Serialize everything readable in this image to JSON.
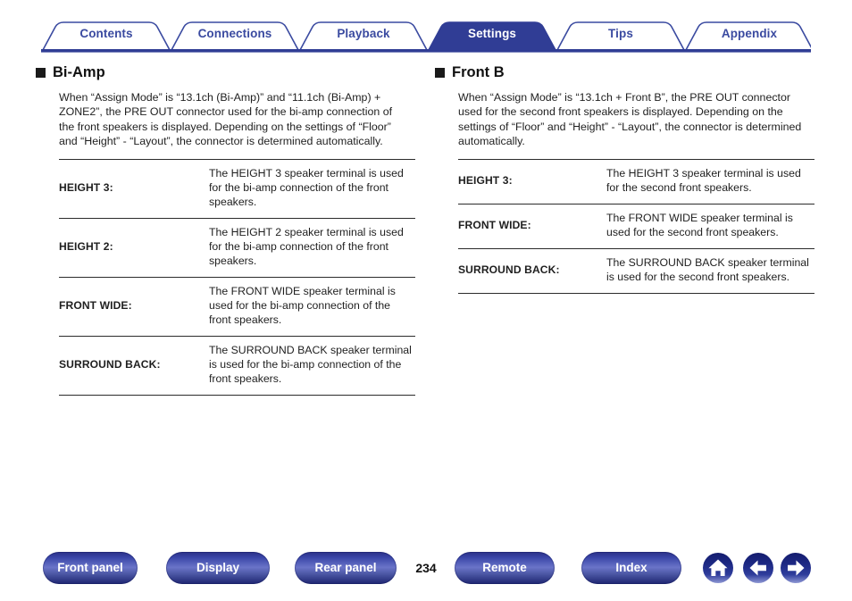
{
  "tabs": [
    {
      "label": "Contents",
      "active": false
    },
    {
      "label": "Connections",
      "active": false
    },
    {
      "label": "Playback",
      "active": false
    },
    {
      "label": "Settings",
      "active": true
    },
    {
      "label": "Tips",
      "active": false
    },
    {
      "label": "Appendix",
      "active": false
    }
  ],
  "colors": {
    "tab_text": "#3a4aa0",
    "tab_active_bg": "#303d95",
    "tab_active_text": "#ffffff",
    "rule": "#2b2b2b",
    "button_navy": "#1d2470"
  },
  "left_section": {
    "heading": "Bi-Amp",
    "body": "When “Assign Mode” is “13.1ch (Bi-Amp)” and “11.1ch (Bi-Amp) + ZONE2”, the PRE OUT connector used for the bi-amp connection of the front speakers is displayed. Depending on the settings of “Floor” and “Height” - “Layout”, the connector is determined automatically.",
    "rows": [
      {
        "term": "HEIGHT 3:",
        "desc": "The HEIGHT 3 speaker terminal is used for the bi-amp connection of the front speakers."
      },
      {
        "term": "HEIGHT 2:",
        "desc": "The HEIGHT 2 speaker terminal is used for the bi-amp connection of the front speakers."
      },
      {
        "term": "FRONT WIDE:",
        "desc": "The FRONT WIDE speaker terminal is used for the bi-amp connection of the front speakers."
      },
      {
        "term": "SURROUND BACK:",
        "desc": "The SURROUND BACK speaker terminal is used for the bi-amp connection of the front speakers."
      }
    ]
  },
  "right_section": {
    "heading": "Front B",
    "body": "When “Assign Mode” is “13.1ch + Front B”, the PRE OUT connector used for the second front speakers is displayed. Depending on the settings of “Floor” and “Height” - “Layout”, the connector is determined automatically.",
    "rows": [
      {
        "term": "HEIGHT 3:",
        "desc": "The HEIGHT 3 speaker terminal is used for the second front speakers."
      },
      {
        "term": "FRONT WIDE:",
        "desc": "The FRONT WIDE speaker terminal is used for the second front speakers."
      },
      {
        "term": "SURROUND BACK:",
        "desc": "The SURROUND BACK speaker terminal is used for the second front speakers."
      }
    ]
  },
  "footer": {
    "buttons": [
      {
        "label": "Front panel"
      },
      {
        "label": "Display"
      },
      {
        "label": "Rear panel"
      },
      {
        "label": "Remote"
      },
      {
        "label": "Index"
      }
    ],
    "page_number": "234",
    "icons": [
      {
        "name": "home-icon"
      },
      {
        "name": "arrow-left-icon"
      },
      {
        "name": "arrow-right-icon"
      }
    ]
  }
}
